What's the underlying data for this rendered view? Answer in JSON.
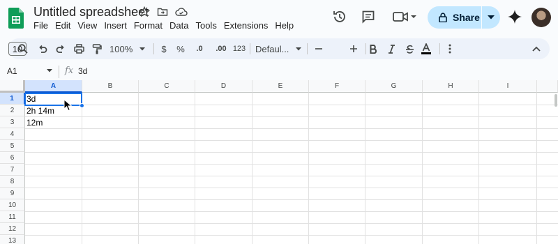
{
  "app": {
    "title": "Untitled spreadsheet",
    "menu": [
      "File",
      "Edit",
      "View",
      "Insert",
      "Format",
      "Data",
      "Tools",
      "Extensions",
      "Help"
    ],
    "share_label": "Share",
    "accent": "#c2e7ff",
    "logo_color": "#0f9d58"
  },
  "toolbar": {
    "zoom": "100%",
    "currency": "$",
    "percent": "%",
    "dec_decrease": ".0",
    "dec_increase": ".00",
    "more_formats": "123",
    "font": "Defaul...",
    "font_size": "10",
    "icons": [
      "search-icon",
      "undo-icon",
      "redo-icon",
      "print-icon",
      "paint-format-icon",
      "minus-icon",
      "plus-icon",
      "bold-icon",
      "italic-icon",
      "strikethrough-icon",
      "text-color-icon",
      "more-vert-icon",
      "collapse-icon"
    ]
  },
  "formula_bar": {
    "name_box": "A1",
    "fx": "fx",
    "value": "3d"
  },
  "grid": {
    "columns": [
      "A",
      "B",
      "C",
      "D",
      "E",
      "F",
      "G",
      "H",
      "I"
    ],
    "rows": [
      "1",
      "2",
      "3",
      "4",
      "5",
      "6",
      "7",
      "8",
      "9",
      "10",
      "11",
      "12",
      "13"
    ],
    "cells": [
      "3d",
      "2h 14m",
      "12m"
    ],
    "selected_cell": "A1",
    "selection_color": "#1a73e8"
  }
}
